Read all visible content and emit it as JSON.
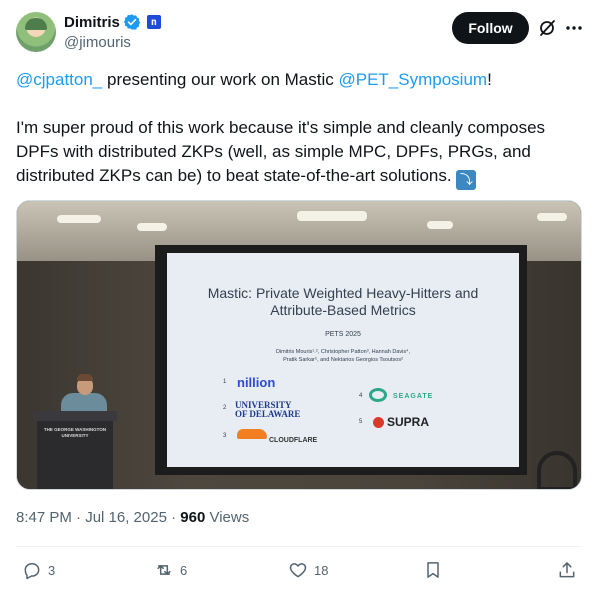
{
  "author": {
    "display_name": "Dimitris",
    "handle": "@jimouris",
    "affiliate_badge": "n"
  },
  "header": {
    "follow_label": "Follow"
  },
  "tweet": {
    "mention_1": "@cjpatton_",
    "text_1": " presenting our work on Mastic ",
    "mention_2": "@PET_Symposium",
    "text_2": "!",
    "paragraph_2": "I'm super proud of this work because it's simple and cleanly composes DPFs with distributed ZKPs (well, as simple MPC, DPFs, PRGs, and distributed ZKPs can be) to beat state-of-the-art solutions. ",
    "emoji": "⤵"
  },
  "media": {
    "slide_title_line1": "Mastic: Private Weighted Heavy-Hitters and",
    "slide_title_line2": "Attribute-Based Metrics",
    "slide_subtitle": "PETS 2025",
    "slide_authors_line1": "Dimitris Mouris¹˒², Christopher Patton³, Hannah Davis⁴,",
    "slide_authors_line2": "Pratik Sarkar⁵, and Nektarios Georgios Tsoutsos²",
    "affiliations": [
      {
        "num": "1",
        "name": "nillion"
      },
      {
        "num": "2",
        "name": "UNIVERSITY OF DELAWARE"
      },
      {
        "num": "3",
        "name": "CLOUDFLARE"
      },
      {
        "num": "4",
        "name": "SEAGATE"
      },
      {
        "num": "5",
        "name": "SUPRA"
      }
    ],
    "podium_label": "THE GEORGE WASHINGTON UNIVERSITY"
  },
  "meta": {
    "timestamp": "8:47 PM · Jul 16, 2025 · ",
    "views_count": "960",
    "views_label": " Views"
  },
  "actions": {
    "replies": "3",
    "reposts": "6",
    "likes": "18"
  },
  "colors": {
    "link": "#1d9bf0",
    "text": "#0f1419",
    "muted": "#536471",
    "verified": "#1d9bf0"
  }
}
